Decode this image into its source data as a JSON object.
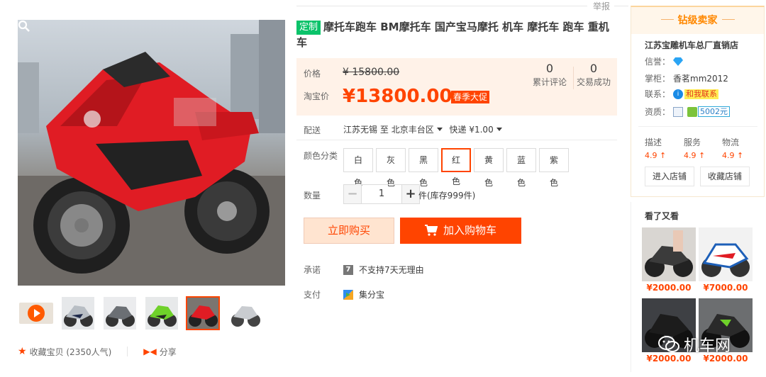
{
  "top": {
    "report": "举报"
  },
  "product": {
    "tag": "定制",
    "title": "摩托车跑车 BM摩托车 国产宝马摩托 机车 摩托车 跑车 重机车"
  },
  "price": {
    "orig_label": "价格",
    "orig_value": "¥ 15800.00",
    "sale_label": "淘宝价",
    "sale_value": "¥13800.00",
    "promo_tag": "春季大促",
    "stats": [
      {
        "num": "0",
        "caption": "累计评论"
      },
      {
        "num": "0",
        "caption": "交易成功"
      }
    ]
  },
  "shipping": {
    "label": "配送",
    "from": "江苏无锡",
    "to_word": "至",
    "to": "北京丰台区",
    "method": "快递 ¥1.00"
  },
  "colors": {
    "label": "颜色分类",
    "options": [
      "白色",
      "灰色",
      "黑色",
      "红色",
      "黄色",
      "蓝色",
      "紫色"
    ],
    "selected": "红色"
  },
  "quantity": {
    "label": "数量",
    "value": "1",
    "minus": "−",
    "plus": "+",
    "stock": "件(库存999件)"
  },
  "buttons": {
    "buy": "立即购买",
    "cart": "加入购物车"
  },
  "promise": {
    "label": "承诺",
    "icon": "7",
    "text": "不支持7天无理由"
  },
  "payment": {
    "label": "支付",
    "text": "集分宝"
  },
  "gallery": {
    "thumb_colors": [
      "silver",
      "grey",
      "green",
      "red",
      "white"
    ],
    "selected_index": 3
  },
  "favorite": {
    "text": "收藏宝贝 (2350人气)",
    "share": "分享"
  },
  "seller": {
    "level": "钻级卖家",
    "shop_name": "江苏宝雕机车总厂直销店",
    "credit_label": "信誉：",
    "manager_label": "掌柜：",
    "manager": "香茗mm2012",
    "contact_label": "联系：",
    "contact_badge": "和我联系",
    "qual_label": "资质：",
    "deposit": "5002元",
    "scores": [
      {
        "label": "描述",
        "value": "4.9 ↑"
      },
      {
        "label": "服务",
        "value": "4.9 ↑"
      },
      {
        "label": "物流",
        "value": "4.9 ↑"
      }
    ],
    "enter_shop": "进入店铺",
    "fav_shop": "收藏店铺"
  },
  "also_viewed": {
    "title": "看了又看",
    "items": [
      {
        "price": "¥2000.00"
      },
      {
        "price": "¥7000.00"
      },
      {
        "price": "¥2000.00"
      },
      {
        "price": "¥2000.00"
      }
    ]
  },
  "watermark": "机车网",
  "colors_palette": {
    "accent": "#ff4400",
    "green_tag": "#0bc36a",
    "price_bg": "#fff2e8"
  }
}
